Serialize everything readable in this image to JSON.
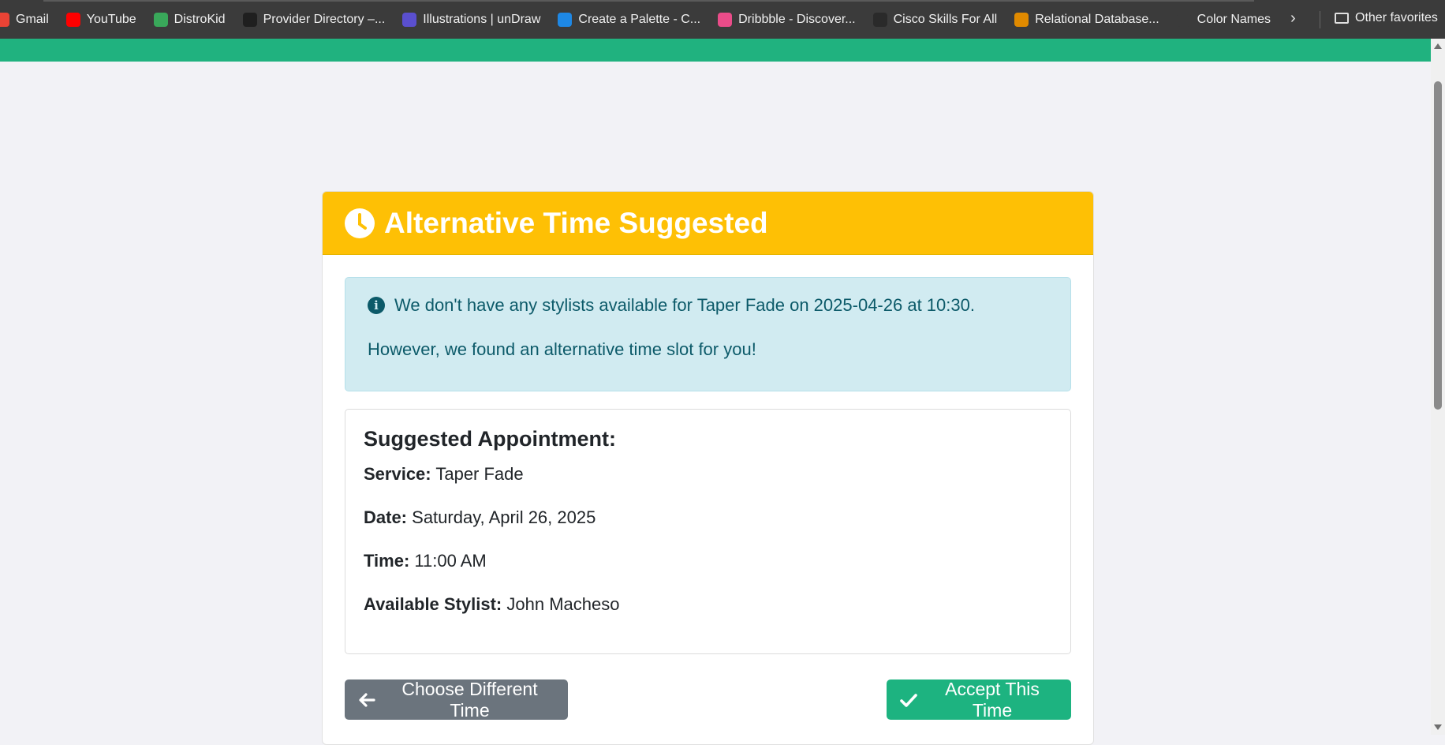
{
  "bookmarks": [
    {
      "label": "Gmail",
      "color": "#ea4335"
    },
    {
      "label": "YouTube",
      "color": "#ff0000"
    },
    {
      "label": "DistroKid",
      "color": "#39a85a"
    },
    {
      "label": "Provider Directory –...",
      "color": "#1f1f1f"
    },
    {
      "label": "Illustrations | unDraw",
      "color": "#5a4fcf"
    },
    {
      "label": "Create a Palette - C...",
      "color": "#1e88e5"
    },
    {
      "label": "Dribbble - Discover...",
      "color": "#ea4c89"
    },
    {
      "label": "Cisco Skills For All",
      "color": "#2a2a2a"
    },
    {
      "label": "Relational Database...",
      "color": "#e08a00"
    },
    {
      "label": "Color Names",
      "color": "#3b3b3b"
    }
  ],
  "other_favorites": "Other favorites",
  "card": {
    "title": "Alternative Time Suggested",
    "alert_line1": "We don't have any stylists available for Taper Fade on 2025-04-26 at 10:30.",
    "alert_line2": "However, we found an alternative time slot for you!",
    "heading": "Suggested Appointment:",
    "service_label": "Service:",
    "service_value": "Taper Fade",
    "date_label": "Date:",
    "date_value": "Saturday, April 26, 2025",
    "time_label": "Time:",
    "time_value": "11:00 AM",
    "stylist_label": "Available Stylist:",
    "stylist_value": "John Macheso",
    "back_button": "Choose Different Time",
    "accept_button": "Accept This Time"
  },
  "colors": {
    "header": "#fec005",
    "nav": "#20b27f",
    "accept": "#1db380",
    "back": "#6b747d",
    "alert_bg": "#d1ebf1"
  }
}
